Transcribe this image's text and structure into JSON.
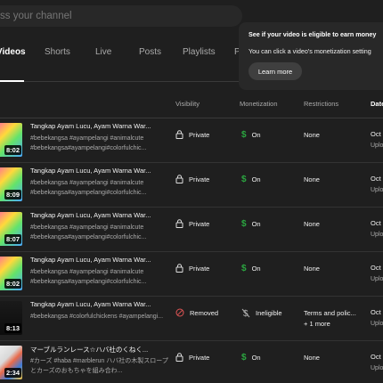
{
  "search": {
    "placeholder": "ss your channel"
  },
  "tabs": [
    {
      "label": "Videos",
      "active": true
    },
    {
      "label": "Shorts"
    },
    {
      "label": "Live"
    },
    {
      "label": "Posts"
    },
    {
      "label": "Playlists"
    },
    {
      "label": "P"
    }
  ],
  "columns": {
    "visibility": "Visibility",
    "monetization": "Monetization",
    "restrictions": "Restrictions",
    "date": "Date"
  },
  "tooltip": {
    "title": "See if your video is eligible to earn money",
    "body": "You can click a video's monetization setting",
    "button": "Learn more"
  },
  "rows": [
    {
      "duration": "8:02",
      "title": "Tangkap Ayam Lucu, Ayam Warna War...",
      "desc": "#bebekangsa #ayampelangi #animalcute #bebekangsa#ayampelangi#colorfulchic...",
      "visibility": "Private",
      "monetization": "On",
      "restrictions": "None",
      "date": "Oct",
      "date_sub": "Uplo"
    },
    {
      "duration": "8:09",
      "title": "Tangkap Ayam Lucu, Ayam Warna War...",
      "desc": "#bebekangsa #ayampelangi #animalcute #bebekangsa#ayampelangi#colorfulchic...",
      "visibility": "Private",
      "monetization": "On",
      "restrictions": "None",
      "date": "Oct",
      "date_sub": "Uplo"
    },
    {
      "duration": "8:07",
      "title": "Tangkap Ayam Lucu, Ayam Warna War...",
      "desc": "#bebekangsa #ayampelangi #animalcute #bebekangsa#ayampelangi#colorfulchic...",
      "visibility": "Private",
      "monetization": "On",
      "restrictions": "None",
      "date": "Oct",
      "date_sub": "Uplo"
    },
    {
      "duration": "8:02",
      "title": "Tangkap Ayam Lucu, Ayam Warna War...",
      "desc": "#bebekangsa #ayampelangi #animalcute #bebekangsa#ayampelangi#colorfulchic...",
      "visibility": "Private",
      "monetization": "On",
      "restrictions": "None",
      "date": "Oct",
      "date_sub": "Uplo"
    },
    {
      "duration": "8:13",
      "title": "Tangkap Ayam Lucu, Ayam Warna War...",
      "desc": "#bebekangsa #colorfulchickens #ayampelangi...",
      "visibility": "Removed",
      "monetization": "Ineligible",
      "restrictions": "Terms and polic...",
      "restrictions_more": "+ 1 more",
      "date": "Oct",
      "date_sub": "Uplo"
    },
    {
      "duration": "2:34",
      "title": "マーブルランレース☆ハバ社のくねく...",
      "desc": "#カーズ #haba #marblerun ハバ社の木製スロープとカーズのおもちゃを組み合わ...",
      "visibility": "Private",
      "monetization": "On",
      "restrictions": "None",
      "date": "Oct",
      "date_sub": "Uplo"
    }
  ]
}
